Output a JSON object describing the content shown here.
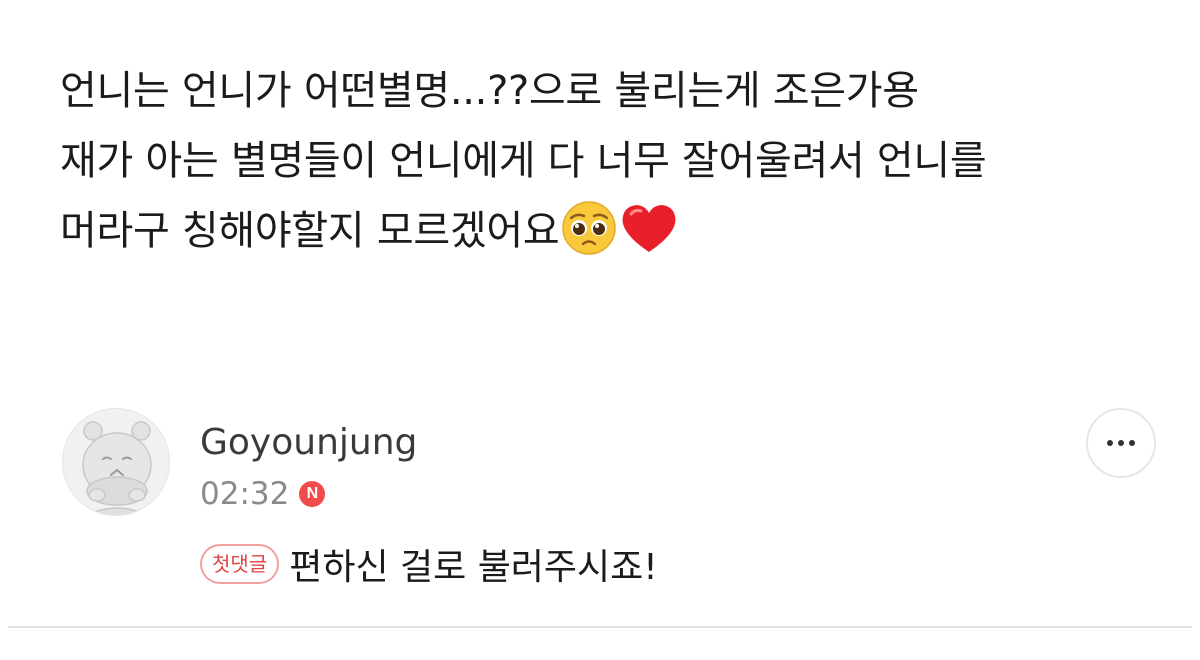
{
  "post": {
    "lines": [
      "언니는 언니가 어떤별명...??으로 불리는게 조은가용",
      "재가 아는 별명들이 언니에게 다 너무 잘어울려서 언니를",
      "머라구 칭해야할지 모르겠어요"
    ],
    "trailing_emojis": [
      "pleading-face-emoji",
      "red-heart-emoji"
    ]
  },
  "comment": {
    "avatar_icon": "hippo-avatar-icon",
    "username": "Goyounjung",
    "time": "02:32",
    "new_badge": "N",
    "first_comment_badge": "첫댓글",
    "text": "편하신 걸로 불러주시죠!",
    "more_icon": "more-options-icon"
  },
  "colors": {
    "badge_red": "#f24b4b",
    "text": "#1b1b1b",
    "meta_gray": "#8a8a8a",
    "divider": "#e3e3e3"
  }
}
